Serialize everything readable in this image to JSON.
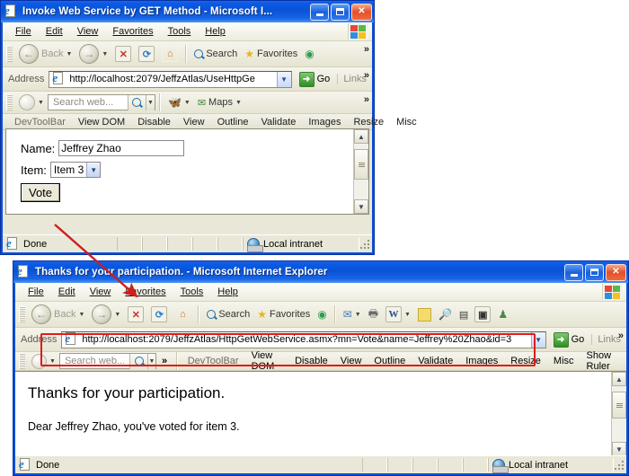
{
  "window1": {
    "title": "Invoke Web Service by GET Method - Microsoft I...",
    "app_icon": "ie-document-icon",
    "window_buttons": {
      "minimize": "Minimize",
      "maximize": "Maximize",
      "close": "Close"
    },
    "menu": [
      "File",
      "Edit",
      "View",
      "Favorites",
      "Tools",
      "Help"
    ],
    "toolbar": {
      "back": "Back",
      "forward": "",
      "stop": "stop-icon",
      "refresh": "refresh-icon",
      "home": "home-icon",
      "search": "Search",
      "favorites": "Favorites",
      "history": "history-icon",
      "overflow": "»"
    },
    "address": {
      "label": "Address",
      "url": "http://localhost:2079/JeffzAtlas/UseHttpGe",
      "go": "Go",
      "links": "Links",
      "overflow": "»"
    },
    "searchbar": {
      "placeholder": "Search web...",
      "maps": "Maps",
      "overflow": "»"
    },
    "devbar": [
      "DevToolBar",
      "View DOM",
      "Disable",
      "View",
      "Outline",
      "Validate",
      "Images",
      "Resize",
      "Misc"
    ],
    "page": {
      "name_label": "Name:",
      "name_value": "Jeffrey Zhao",
      "item_label": "Item:",
      "item_value": "Item 3",
      "vote_button": "Vote"
    },
    "status": {
      "text": "Done",
      "zone": "Local intranet"
    }
  },
  "window2": {
    "title": "Thanks for your participation. - Microsoft Internet Explorer",
    "app_icon": "ie-document-icon",
    "window_buttons": {
      "minimize": "Minimize",
      "maximize": "Maximize",
      "close": "Close"
    },
    "menu": [
      "File",
      "Edit",
      "View",
      "Favorites",
      "Tools",
      "Help"
    ],
    "toolbar": {
      "back": "Back",
      "forward": "",
      "stop": "stop-icon",
      "refresh": "refresh-icon",
      "home": "home-icon",
      "search": "Search",
      "favorites": "Favorites",
      "history": "history-icon",
      "mail": "mail-icon",
      "print": "print-icon",
      "edit_word": "W",
      "notes": "note-icon",
      "research": "research-icon",
      "messenger": "messenger-icon",
      "pdf": "pdf-icon",
      "people": "people-icon"
    },
    "address": {
      "label": "Address",
      "url": "http://localhost:2079/JeffzAtlas/HttpGetWebService.asmx?mn=Vote&name=Jeffrey%20Zhao&id=3",
      "go": "Go",
      "links": "Links",
      "overflow": "»"
    },
    "searchbar": {
      "placeholder": "Search web...",
      "overflow": "»"
    },
    "devbar": [
      "DevToolBar",
      "View DOM",
      "Disable",
      "View",
      "Outline",
      "Validate",
      "Images",
      "Resize",
      "Misc",
      "Show Ruler"
    ],
    "page": {
      "heading": "Thanks for your participation.",
      "body": "Dear Jeffrey Zhao, you've voted for item 3."
    },
    "status": {
      "text": "Done",
      "zone": "Local intranet"
    }
  },
  "annotations": {
    "highlight_color": "#e01b1b",
    "arrow": "red-arrow-from-vote-button-to-second-window",
    "address_highlight": "red-rectangle-around-address-bar"
  }
}
